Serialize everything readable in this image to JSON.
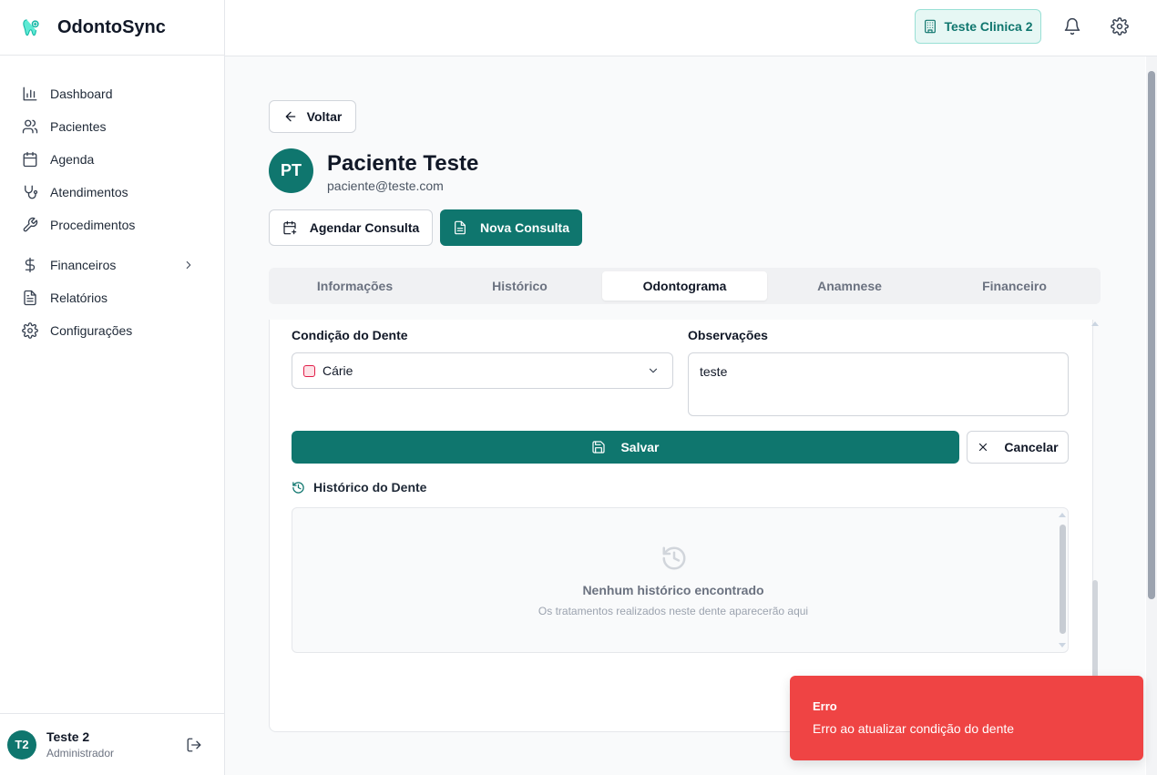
{
  "app": {
    "name": "OdontoSync"
  },
  "sidebar": {
    "items": [
      {
        "label": "Dashboard",
        "icon": "chart-bar-icon"
      },
      {
        "label": "Pacientes",
        "icon": "users-icon"
      },
      {
        "label": "Agenda",
        "icon": "calendar-icon"
      },
      {
        "label": "Atendimentos",
        "icon": "stethoscope-icon"
      },
      {
        "label": "Procedimentos",
        "icon": "wrench-icon"
      },
      {
        "label": "Financeiros",
        "icon": "dollar-icon"
      },
      {
        "label": "Relatórios",
        "icon": "file-text-icon"
      },
      {
        "label": "Configurações",
        "icon": "gear-icon"
      }
    ],
    "user": {
      "initials": "T2",
      "name": "Teste 2",
      "role": "Administrador"
    }
  },
  "header": {
    "clinic_label": "Teste Clinica 2"
  },
  "patient": {
    "back_label": "Voltar",
    "initials": "PT",
    "name": "Paciente Teste",
    "email": "paciente@teste.com",
    "schedule_label": "Agendar Consulta",
    "new_consult_label": "Nova Consulta"
  },
  "tabs": [
    {
      "label": "Informações",
      "active": false
    },
    {
      "label": "Histórico",
      "active": false
    },
    {
      "label": "Odontograma",
      "active": true
    },
    {
      "label": "Anamnese",
      "active": false
    },
    {
      "label": "Financeiro",
      "active": false
    }
  ],
  "form": {
    "condition_label": "Condição do Dente",
    "condition_value": "Cárie",
    "notes_label": "Observações",
    "notes_value": "teste",
    "save_label": "Salvar",
    "cancel_label": "Cancelar"
  },
  "history": {
    "title": "Histórico do Dente",
    "empty_title": "Nenhum histórico encontrado",
    "empty_subtitle": "Os tratamentos realizados neste dente aparecerão aqui"
  },
  "toast": {
    "title": "Erro",
    "message": "Erro ao atualizar condição do dente"
  },
  "colors": {
    "primary": "#0f766e",
    "error": "#ef4444"
  }
}
